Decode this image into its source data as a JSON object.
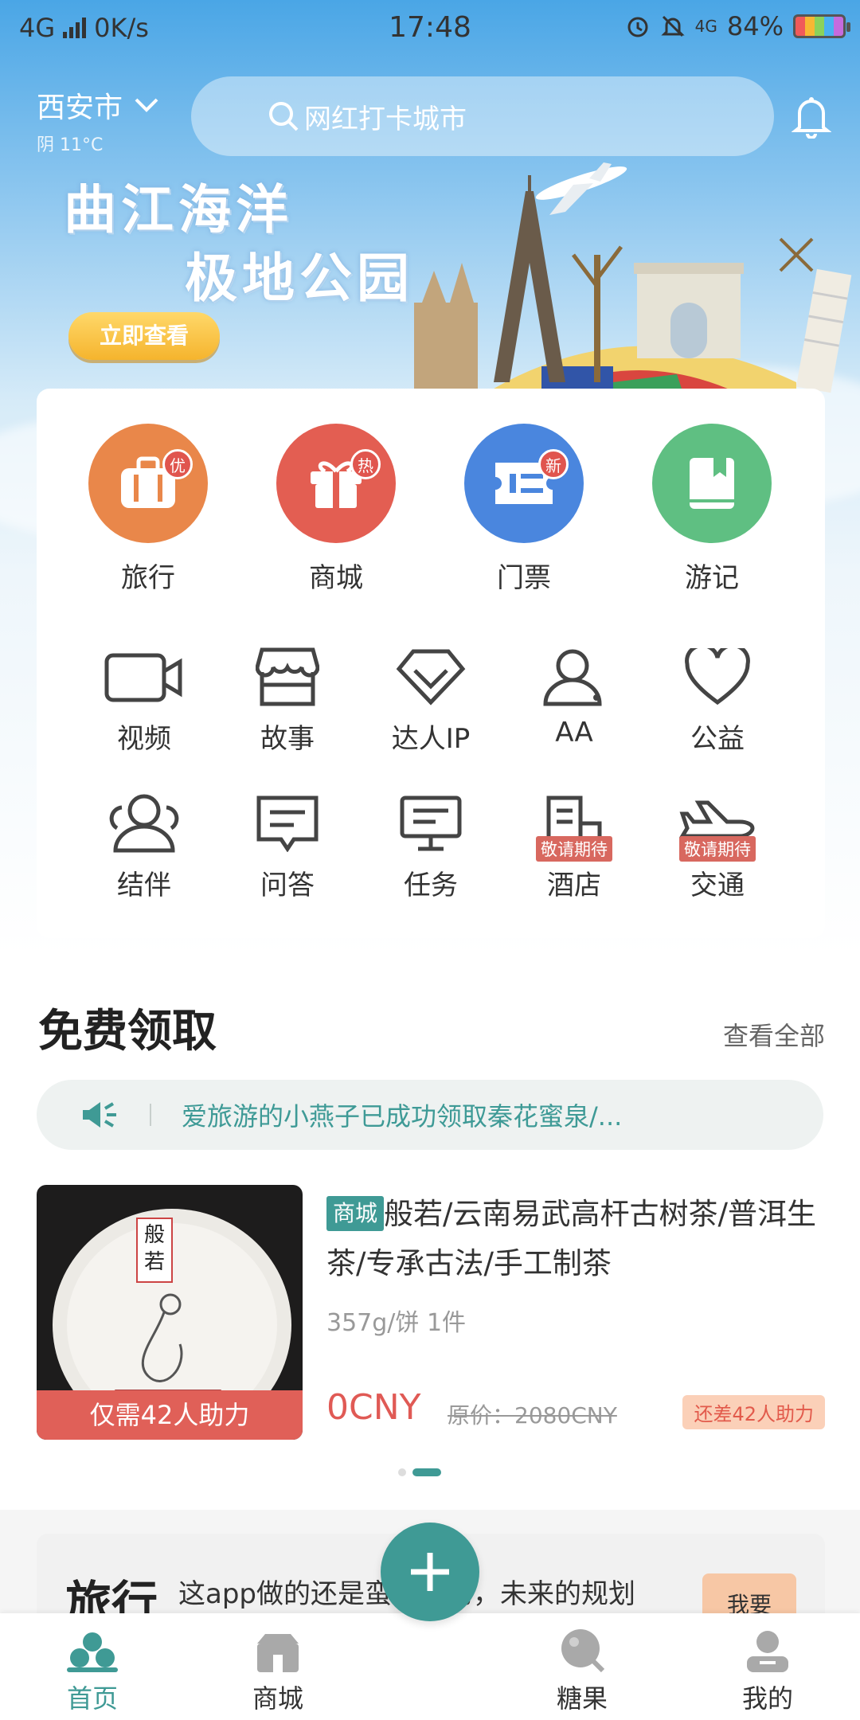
{
  "status_bar": {
    "network": "4G",
    "speed": "0K/s",
    "time": "17:48",
    "right_network": "4G",
    "battery": "84%"
  },
  "header": {
    "city": "西安市",
    "weather": "阴 11°C",
    "search_placeholder": "网红打卡城市"
  },
  "banner": {
    "title_line1": "曲江海洋",
    "title_line2": "极地公园",
    "button": "立即查看"
  },
  "main_icons": [
    {
      "label": "旅行",
      "badge": "优",
      "color": "#e9874a",
      "icon": "suitcase-icon"
    },
    {
      "label": "商城",
      "badge": "热",
      "color": "#e35e52",
      "icon": "gift-icon"
    },
    {
      "label": "门票",
      "badge": "新",
      "color": "#4a86de",
      "icon": "ticket-icon"
    },
    {
      "label": "游记",
      "badge": "",
      "color": "#5fbf82",
      "icon": "book-icon"
    }
  ],
  "row2": [
    {
      "label": "视频",
      "icon": "video-icon"
    },
    {
      "label": "故事",
      "icon": "store-icon"
    },
    {
      "label": "达人IP",
      "icon": "diamond-icon"
    },
    {
      "label": "AA",
      "icon": "users-icon"
    },
    {
      "label": "公益",
      "icon": "heart-icon"
    }
  ],
  "row3": [
    {
      "label": "结伴",
      "icon": "companion-icon",
      "tag": ""
    },
    {
      "label": "问答",
      "icon": "chat-icon",
      "tag": ""
    },
    {
      "label": "任务",
      "icon": "monitor-icon",
      "tag": ""
    },
    {
      "label": "酒店",
      "icon": "hotel-icon",
      "tag": "敬请期待"
    },
    {
      "label": "交通",
      "icon": "plane-icon",
      "tag": "敬请期待"
    }
  ],
  "free_section": {
    "title": "免费领取",
    "view_all": "查看全部",
    "notice": "爱旅游的小燕子已成功领取秦花蜜泉/...",
    "product": {
      "image_text": "般若",
      "help_needed": "仅需42人助力",
      "chip": "商城",
      "title": "般若/云南易武高杆古树茶/普洱生茶/专承古法/手工制茶",
      "spec": "357g/饼 1件",
      "price": "0CNY",
      "original_price": "原价：2080CNY",
      "remaining": "还差42人助力"
    }
  },
  "travel_preview": {
    "heading": "旅行",
    "text": "这app做的还是蛮精致的，未来的规划",
    "button": "我要"
  },
  "tabbar": [
    {
      "label": "首页",
      "icon": "home-clover-icon",
      "active": true
    },
    {
      "label": "商城",
      "icon": "shop-icon",
      "active": false
    },
    {
      "label": "糖果",
      "icon": "candy-icon",
      "active": false
    },
    {
      "label": "我的",
      "icon": "profile-icon",
      "active": false
    }
  ],
  "colors": {
    "accent": "#3f9a95",
    "price_red": "#e05a55"
  }
}
